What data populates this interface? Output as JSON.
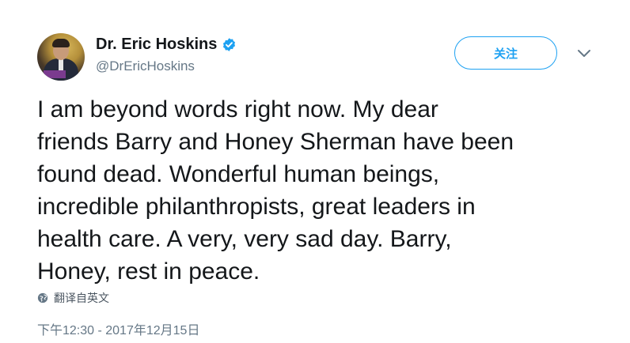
{
  "author": {
    "display_name": "Dr. Eric Hoskins",
    "handle": "@DrEricHoskins",
    "verified": true,
    "verified_color": "#1da1f2"
  },
  "actions": {
    "follow_label": "关注",
    "menu_icon": "chevron-down-icon"
  },
  "tweet": {
    "text": "I am beyond words right now. My dear\nfriends Barry and Honey Sherman have been\nfound dead. Wonderful human beings,\nincredible philanthropists, great leaders in\nhealth care. A very, very sad day. Barry,\nHoney, rest in peace.",
    "translate_label": "翻译自英文",
    "timestamp": "下午12:30 - 2017年12月15日"
  },
  "colors": {
    "accent": "#1da1f2",
    "text_primary": "#14171a",
    "text_secondary": "#657786"
  }
}
